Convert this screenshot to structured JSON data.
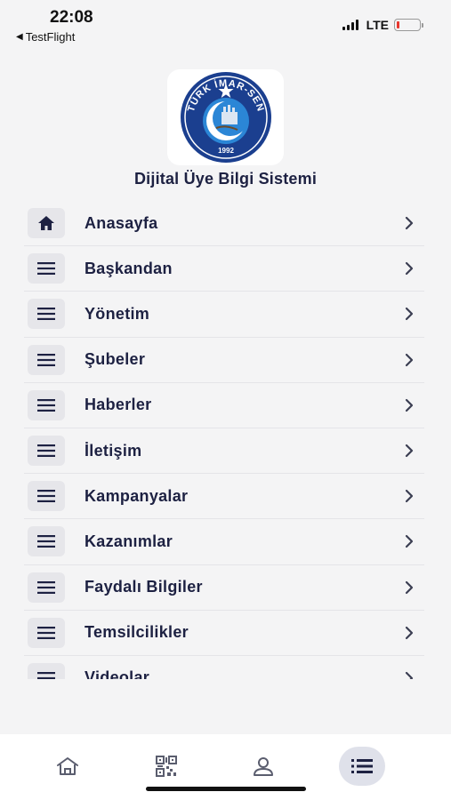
{
  "status_bar": {
    "time": "22:08",
    "back_app": "TestFlight",
    "network": "LTE"
  },
  "colors": {
    "primary": "#1d2142",
    "icon_bg": "#e6e6ea",
    "background": "#f4f4f5",
    "battery_low": "#e8372e"
  },
  "logo": {
    "text": "TÜRK İMAR-SEN",
    "year": "1992"
  },
  "app_title": "Dijital Üye Bilgi Sistemi",
  "menu": [
    {
      "label": "Anasayfa",
      "icon": "home-icon"
    },
    {
      "label": "Başkandan",
      "icon": "menu-lines-icon"
    },
    {
      "label": "Yönetim",
      "icon": "menu-lines-icon"
    },
    {
      "label": "Şubeler",
      "icon": "menu-lines-icon"
    },
    {
      "label": "Haberler",
      "icon": "menu-lines-icon"
    },
    {
      "label": "İletişim",
      "icon": "menu-lines-icon"
    },
    {
      "label": "Kampanyalar",
      "icon": "menu-lines-icon"
    },
    {
      "label": "Kazanımlar",
      "icon": "menu-lines-icon"
    },
    {
      "label": "Faydalı Bilgiler",
      "icon": "menu-lines-icon"
    },
    {
      "label": "Temsilcilikler",
      "icon": "menu-lines-icon"
    },
    {
      "label": "Videolar",
      "icon": "menu-lines-icon"
    }
  ],
  "tabs": [
    {
      "icon": "home-icon",
      "active": false
    },
    {
      "icon": "qr-code-icon",
      "active": false
    },
    {
      "icon": "user-icon",
      "active": false
    },
    {
      "icon": "list-icon",
      "active": true
    }
  ]
}
